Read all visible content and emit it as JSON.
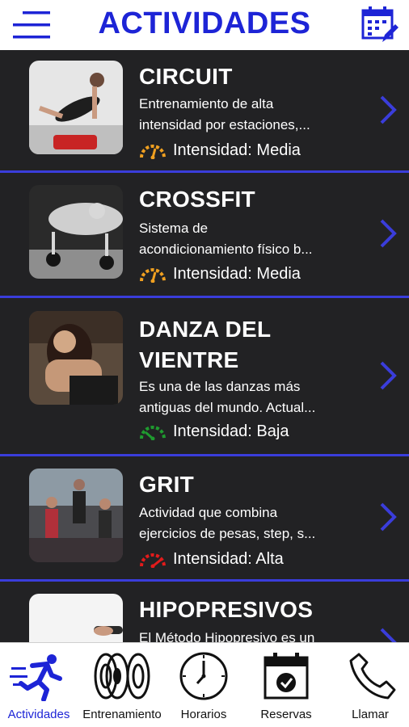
{
  "header": {
    "title": "ACTIVIDADES"
  },
  "activities": [
    {
      "name_lines": [
        "CIRCUIT"
      ],
      "desc_lines": [
        "Entrenamiento de alta",
        "intensidad por estaciones,..."
      ],
      "intensity": "Intensidad: Media",
      "gauge_color": "#f0a020"
    },
    {
      "name_lines": [
        "CROSSFIT"
      ],
      "desc_lines": [
        "Sistema de",
        "acondicionamiento físico b..."
      ],
      "intensity": "Intensidad: Media",
      "gauge_color": "#f0a020"
    },
    {
      "name_lines": [
        "DANZA DEL",
        "VIENTRE"
      ],
      "desc_lines": [
        "Es una de las danzas más",
        "antiguas del mundo. Actual..."
      ],
      "intensity": "Intensidad: Baja",
      "gauge_color": "#1f9a2f"
    },
    {
      "name_lines": [
        "GRIT"
      ],
      "desc_lines": [
        "Actividad que combina",
        "ejercicios de pesas, step, s..."
      ],
      "intensity": "Intensidad: Alta",
      "gauge_color": "#e21b1b"
    },
    {
      "name_lines": [
        "HIPOPRESIVOS"
      ],
      "desc_lines": [
        "El Método Hipopresivo es un"
      ],
      "intensity": "",
      "gauge_color": ""
    }
  ],
  "nav": [
    {
      "label": "Actividades",
      "icon": "running-icon",
      "active": true
    },
    {
      "label": "Entrenamiento",
      "icon": "weights-icon",
      "active": false
    },
    {
      "label": "Horarios",
      "icon": "clock-icon",
      "active": false
    },
    {
      "label": "Reservas",
      "icon": "calendar-check-icon",
      "active": false
    },
    {
      "label": "Llamar",
      "icon": "phone-icon",
      "active": false
    }
  ],
  "colors": {
    "accent": "#1d24d6",
    "divider": "#3a3ddb",
    "background": "#222224"
  }
}
